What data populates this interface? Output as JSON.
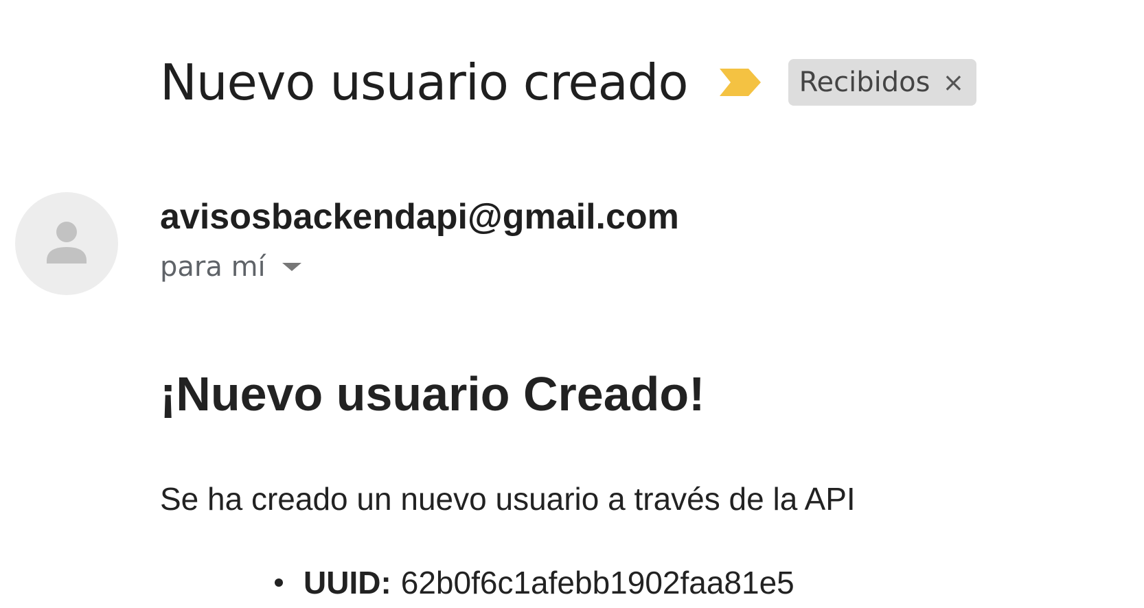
{
  "subject": {
    "title": "Nuevo usuario creado",
    "importance_icon": "importance-marker-icon",
    "importance_color": "#f4c242",
    "label_chip": {
      "label": "Recibidos",
      "close_glyph": "×",
      "background": "#dddddd"
    }
  },
  "message": {
    "avatar_icon": "person-placeholder-icon",
    "sender": "avisosbackendapi@gmail.com",
    "recipient": "para mí",
    "recipient_dropdown_icon": "caret-down-icon"
  },
  "body": {
    "heading": "¡Nuevo usuario Creado!",
    "paragraph": "Se ha creado un nuevo usuario a través de la API",
    "details": [
      {
        "key": "UUID:",
        "value": "62b0f6c1afebb1902faa81e5"
      }
    ]
  }
}
